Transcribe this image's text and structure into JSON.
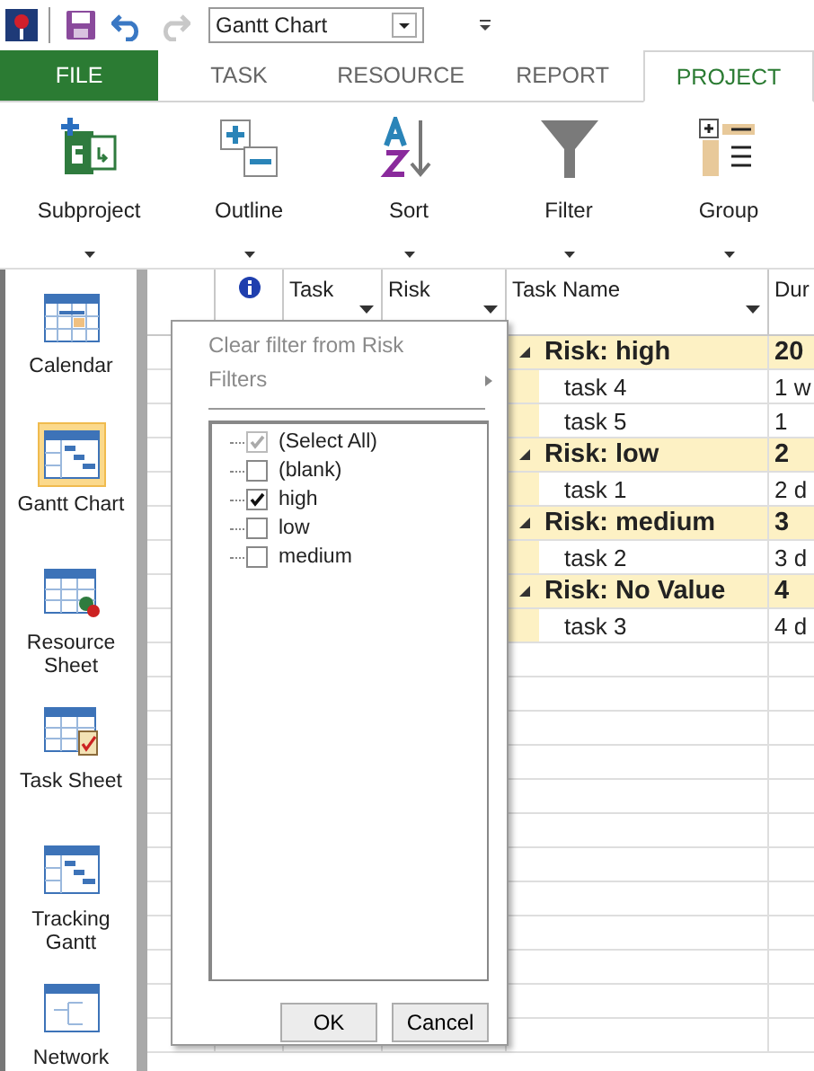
{
  "quick_access": {
    "view_select": "Gantt Chart"
  },
  "tabs": [
    {
      "label": "FILE",
      "kind": "file",
      "selected": false
    },
    {
      "label": "TASK",
      "kind": "tab",
      "selected": false
    },
    {
      "label": "RESOURCE",
      "kind": "tab",
      "selected": false
    },
    {
      "label": "REPORT",
      "kind": "tab",
      "selected": false
    },
    {
      "label": "PROJECT",
      "kind": "tab",
      "selected": true
    }
  ],
  "ribbon": [
    {
      "label": "Subproject",
      "kind": "subproject"
    },
    {
      "label": "Outline",
      "kind": "outline"
    },
    {
      "label": "Sort",
      "kind": "sort"
    },
    {
      "label": "Filter",
      "kind": "filter"
    },
    {
      "label": "Group",
      "kind": "group"
    }
  ],
  "views": [
    {
      "label": "Calendar",
      "kind": "calendar",
      "selected": false
    },
    {
      "label": "Gantt Chart",
      "kind": "gantt",
      "selected": true
    },
    {
      "label": "Resource Sheet",
      "kind": "resource",
      "selected": false
    },
    {
      "label": "Task Sheet",
      "kind": "tasksheet",
      "selected": false
    },
    {
      "label": "Tracking Gantt",
      "kind": "gantt",
      "selected": false
    },
    {
      "label": "Network",
      "kind": "network",
      "selected": false
    }
  ],
  "table": {
    "columns": [
      {
        "label": "Task"
      },
      {
        "label": "Risk"
      },
      {
        "label": "Task Name"
      },
      {
        "label": "Dur"
      }
    ],
    "rows": [
      {
        "kind": "group",
        "name": "Risk: high",
        "duration": "20"
      },
      {
        "kind": "task",
        "name": "task 4",
        "duration": "1 w"
      },
      {
        "kind": "task",
        "name": "task 5",
        "duration": "1"
      },
      {
        "kind": "group",
        "name": "Risk: low",
        "duration": "2"
      },
      {
        "kind": "task",
        "name": "task 1",
        "duration": "2 d"
      },
      {
        "kind": "group",
        "name": "Risk: medium",
        "duration": "3"
      },
      {
        "kind": "task",
        "name": "task 2",
        "duration": "3 d"
      },
      {
        "kind": "group",
        "name": "Risk: No Value",
        "duration": "4"
      },
      {
        "kind": "task",
        "name": "task 3",
        "duration": "4 d"
      }
    ]
  },
  "filter_menu": {
    "clear_item": "Clear filter from Risk",
    "clear_disabled": true,
    "filters_item": "Filters",
    "values": [
      {
        "label": "(Select All)",
        "checked": true,
        "dimmed": true
      },
      {
        "label": "(blank)",
        "checked": false,
        "dimmed": false
      },
      {
        "label": "high",
        "checked": true,
        "dimmed": false
      },
      {
        "label": "low",
        "checked": false,
        "dimmed": false
      },
      {
        "label": "medium",
        "checked": false,
        "dimmed": false
      }
    ],
    "ok": "OK",
    "cancel": "Cancel"
  }
}
